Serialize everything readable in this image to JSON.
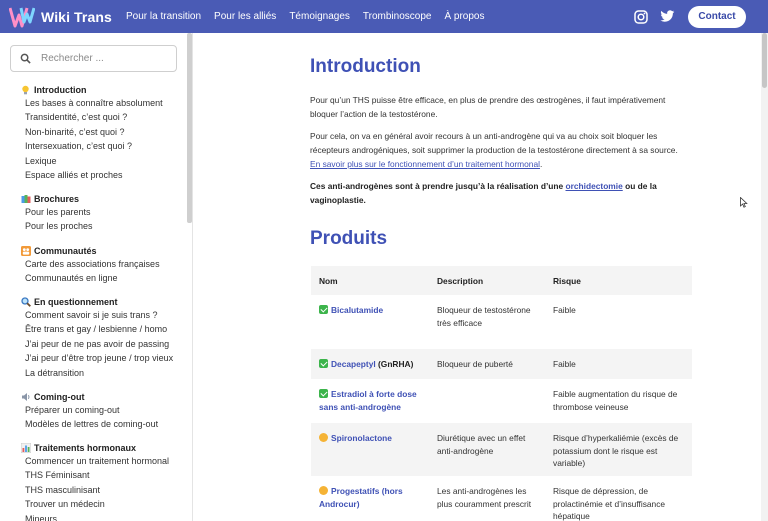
{
  "header": {
    "brand": "Wiki Trans",
    "nav": [
      "Pour la transition",
      "Pour les alliés",
      "Témoignages",
      "Trombinoscope",
      "À propos"
    ],
    "social_icons": [
      "instagram-icon",
      "twitter-icon"
    ],
    "contact_label": "Contact",
    "brand_color": "#4a5bb5"
  },
  "sidebar": {
    "search_placeholder": "Rechercher ...",
    "sections": [
      {
        "emoji": "lightbulb-icon",
        "title": "Introduction",
        "items": [
          "Les bases à connaître absolument",
          "Transidentité, c’est quoi ?",
          "Non-binarité, c’est quoi ?",
          "Intersexuation, c’est quoi ?",
          "Lexique",
          "Espace alliés et proches"
        ]
      },
      {
        "emoji": "books-icon",
        "title": "Brochures",
        "items": [
          "Pour les parents",
          "Pour les proches"
        ]
      },
      {
        "emoji": "people-icon",
        "title": "Communautés",
        "items": [
          "Carte des associations françaises",
          "Communautés en ligne"
        ]
      },
      {
        "emoji": "magnifier-icon",
        "title": "En questionnement",
        "items": [
          "Comment savoir si je suis trans ?",
          "Être trans et gay / lesbienne / homo",
          "J’ai peur de ne pas avoir de passing",
          "J’ai peur d’être trop jeune / trop vieux",
          "La détransition"
        ]
      },
      {
        "emoji": "speaker-icon",
        "title": "Coming-out",
        "items": [
          "Préparer un coming-out",
          "Modèles de lettres de coming-out"
        ]
      },
      {
        "emoji": "chart-icon",
        "title": "Traitements hormonaux",
        "items": [
          "Commencer un traitement hormonal",
          "THS Féminisant",
          "THS masculinisant",
          "Trouver un médecin",
          "Mineurs"
        ]
      }
    ]
  },
  "main": {
    "intro_title": "Introduction",
    "intro_p1": "Pour qu’un THS puisse être efficace, en plus de prendre des œstrogènes, il faut impérativement bloquer l’action de la testostérone.",
    "intro_p2_text": "Pour cela, on va en général avoir recours à un anti-androgène qui va au choix soit bloquer les récepteurs androgéniques, soit supprimer la production de la testostérone directement à sa source. ",
    "intro_p2_link": "En savoir plus sur le fonctionnement d’un traitement hormonal",
    "intro_p2_end": ".",
    "intro_p3_a": "Ces anti-androgènes sont à prendre jusqu’à la réalisation d’une ",
    "intro_p3_link": "orchidectomie",
    "intro_p3_b": " ou de la vaginoplastie.",
    "products_title": "Produits",
    "table": {
      "headers": [
        "Nom",
        "Description",
        "Risque"
      ],
      "rows": [
        {
          "icon": "check-icon",
          "name": "Bicalutamide",
          "suffix": "",
          "description": "Bloqueur de testostérone très efficace",
          "risk": "Faible"
        },
        {
          "icon": "check-icon",
          "name": "Decapeptyl",
          "suffix": " (GnRHA)",
          "description": "Bloqueur de puberté",
          "risk": "Faible"
        },
        {
          "icon": "check-icon",
          "name": "Estradiol à forte dose sans anti-androgène",
          "suffix": "",
          "description": "",
          "risk": "Faible augmentation du risque de thrombose veineuse"
        },
        {
          "icon": "worried-face-icon",
          "name": "Spironolactone",
          "suffix": "",
          "description": "Diurétique avec un effet anti-androgène",
          "risk": "Risque d’hyperkaliémie (excès de potassium dont le risque est variable)"
        },
        {
          "icon": "worried-face-icon",
          "name": "Progestatifs (hors Androcur)",
          "suffix": "",
          "description": "Les anti-androgènes les plus couramment prescrit",
          "risk": "Risque de dépression, de prolactinémie et d’insuffisance hépatique"
        }
      ]
    },
    "link_color": "#3f51b5"
  }
}
